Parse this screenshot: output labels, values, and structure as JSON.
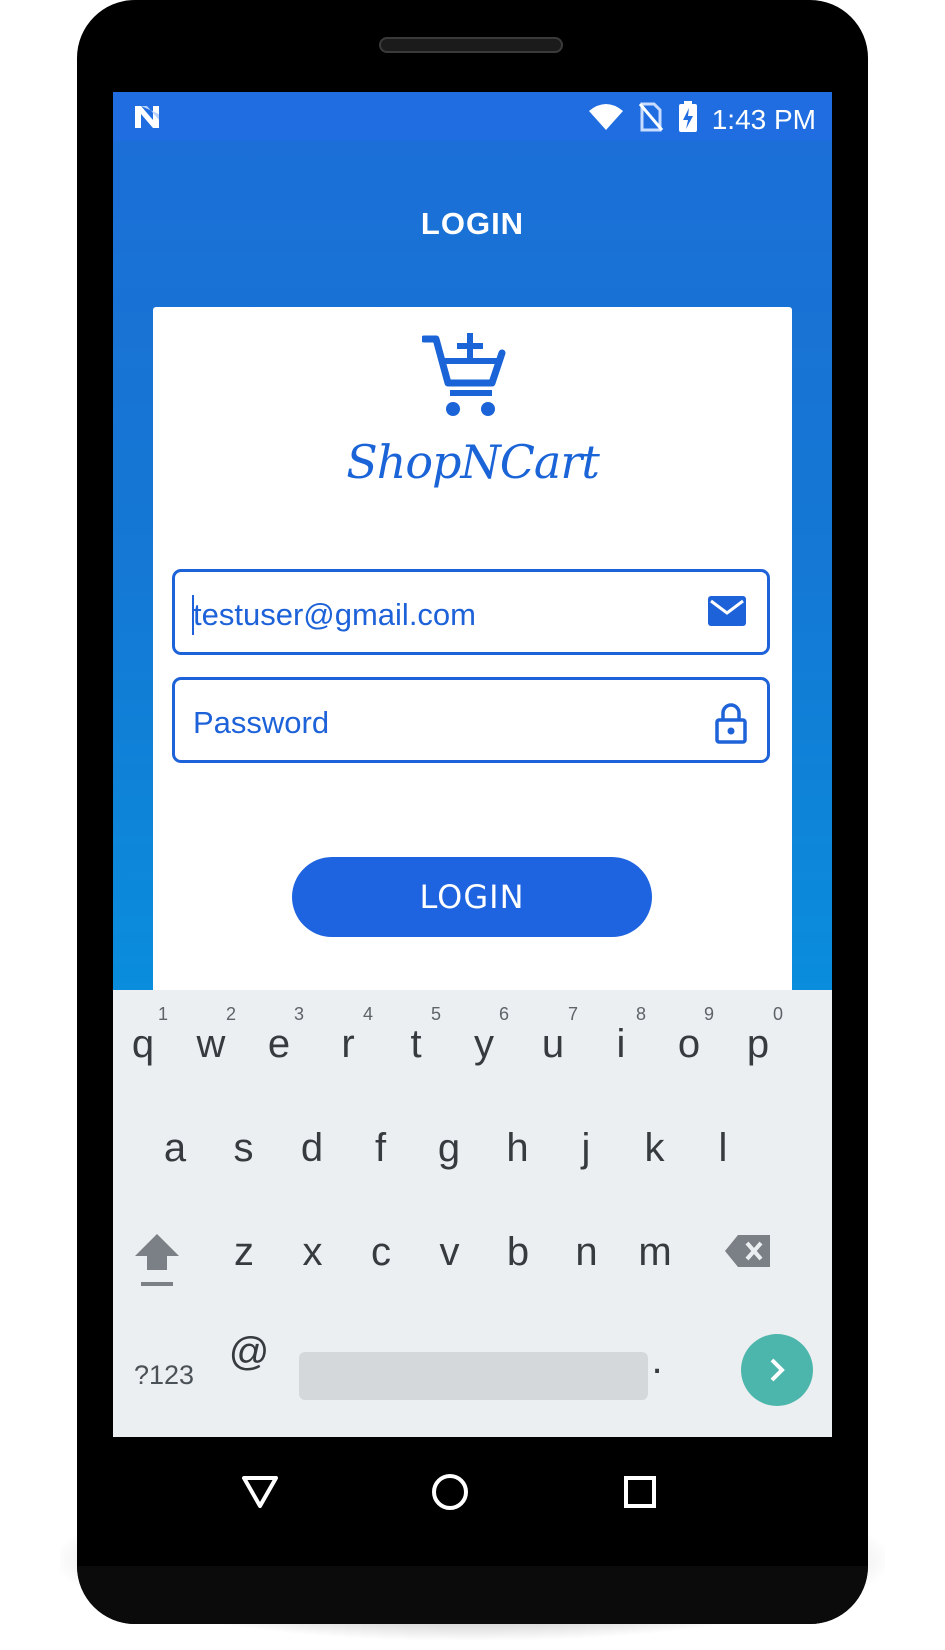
{
  "statusbar": {
    "time": "1:43 PM",
    "icons": [
      "n-logo-icon",
      "wifi-icon",
      "no-sim-icon",
      "battery-charging-icon"
    ]
  },
  "app": {
    "title": "LOGIN",
    "brand": "ShopNCart",
    "logo_icon": "cart-plus-icon",
    "email_value": "testuser@gmail.com",
    "email_icon": "envelope-icon",
    "password_placeholder": "Password",
    "password_icon": "lock-icon",
    "login_button": "LOGIN"
  },
  "keyboard": {
    "row1": [
      "q",
      "w",
      "e",
      "r",
      "t",
      "y",
      "u",
      "i",
      "o",
      "p"
    ],
    "row1_hints": [
      "1",
      "2",
      "3",
      "4",
      "5",
      "6",
      "7",
      "8",
      "9",
      "0"
    ],
    "row2": [
      "a",
      "s",
      "d",
      "f",
      "g",
      "h",
      "j",
      "k",
      "l"
    ],
    "row3": [
      "z",
      "x",
      "c",
      "v",
      "b",
      "n",
      "m"
    ],
    "symbols_key": "?123",
    "at_key": "@",
    "period_key": ".",
    "shift_icon": "shift-icon",
    "backspace_icon": "backspace-icon",
    "go_icon": "chevron-right-icon"
  },
  "navbar": {
    "icons": [
      "back-triangle-icon",
      "home-circle-icon",
      "recents-square-icon"
    ]
  },
  "colors": {
    "accent": "#1e63df",
    "statusbar": "#1f6de0",
    "keyboard_bg": "#eceff1",
    "go_key": "#4db6ac"
  }
}
